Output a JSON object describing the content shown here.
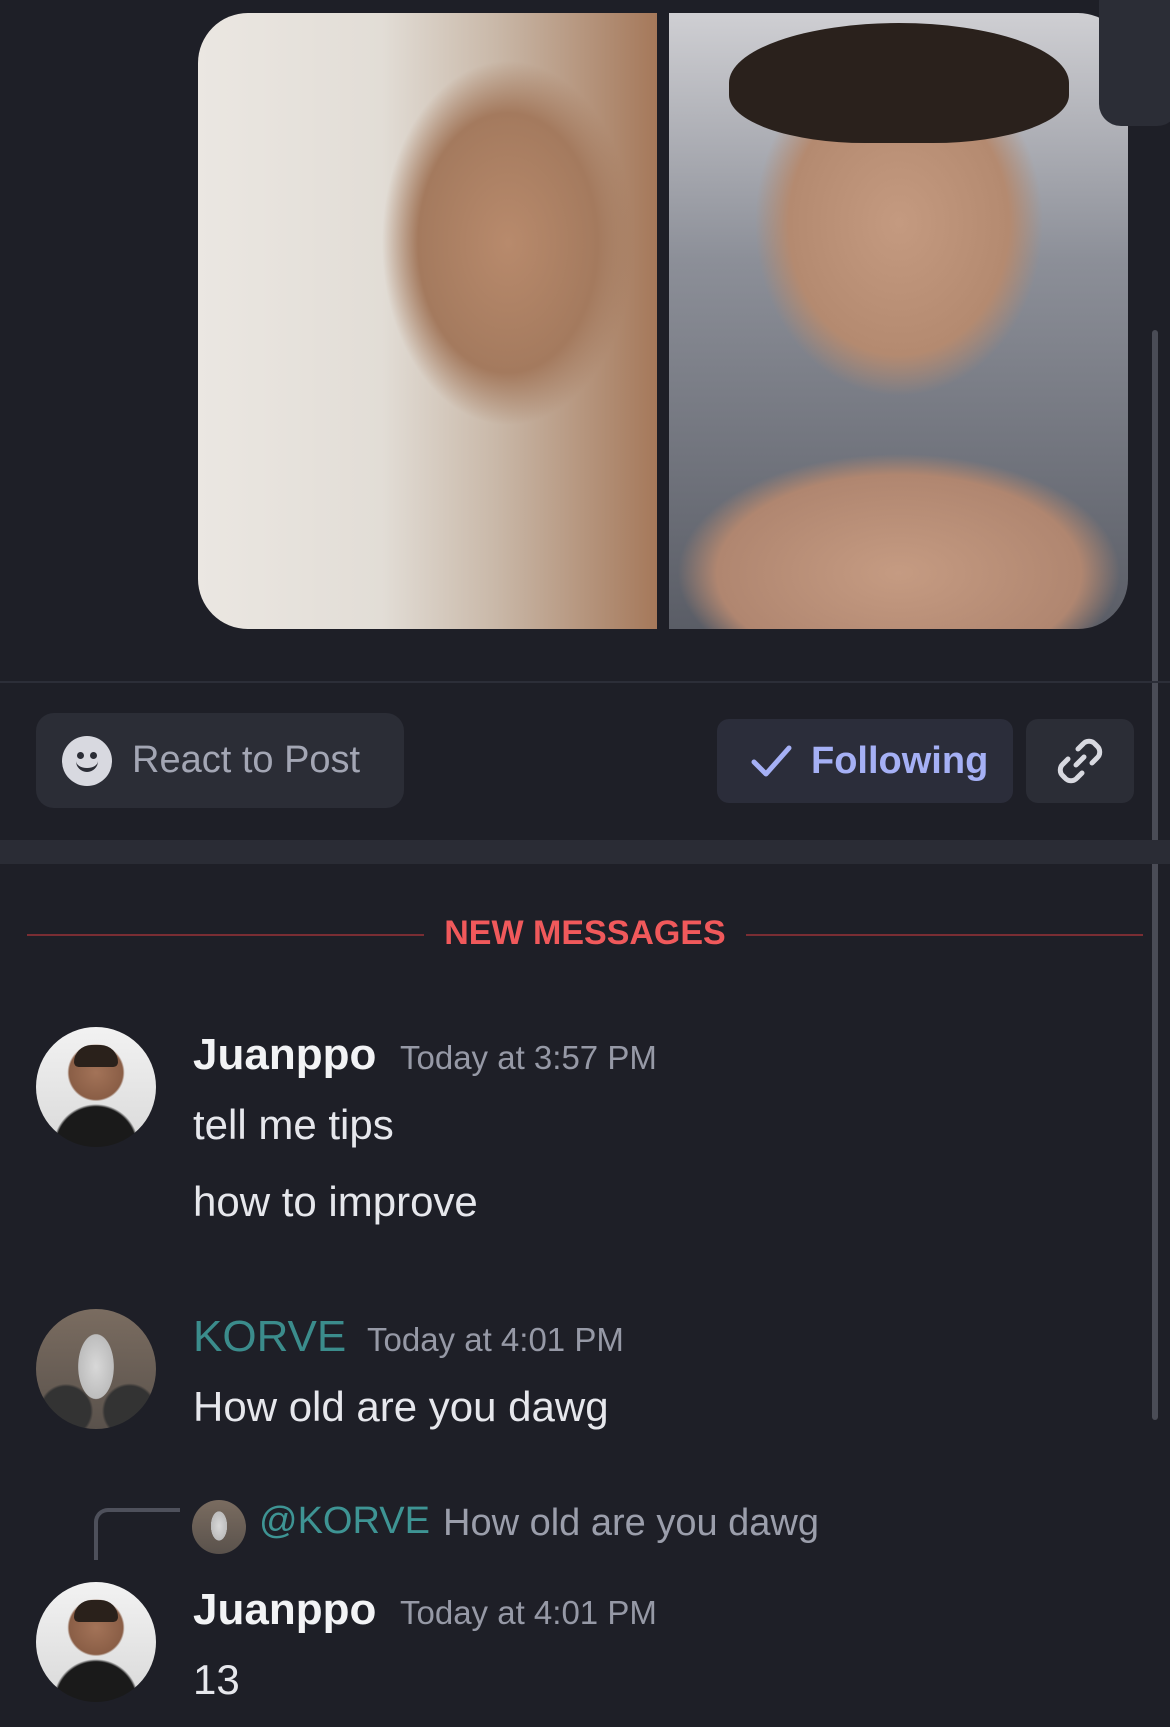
{
  "post": {
    "images": [
      {
        "alt": "photo-left"
      },
      {
        "alt": "photo-right"
      }
    ]
  },
  "actions": {
    "react_label": "React to Post",
    "following_label": "Following",
    "accent_color": "#a5b0f5"
  },
  "divider": {
    "new_messages_label": "NEW MESSAGES",
    "color": "#f0595b"
  },
  "messages": [
    {
      "author": "Juanppo",
      "timestamp": "Today at 3:57 PM",
      "lines": [
        "tell me tips",
        "how to improve"
      ]
    },
    {
      "author": "KORVE",
      "author_color": "#3b8c8c",
      "timestamp": "Today at 4:01 PM",
      "lines": [
        "How old are you dawg"
      ]
    },
    {
      "reply_to": {
        "mention": "@KORVE",
        "text": "How old are you dawg"
      },
      "author": "Juanppo",
      "timestamp": "Today at 4:01 PM",
      "lines": [
        "13"
      ]
    }
  ]
}
